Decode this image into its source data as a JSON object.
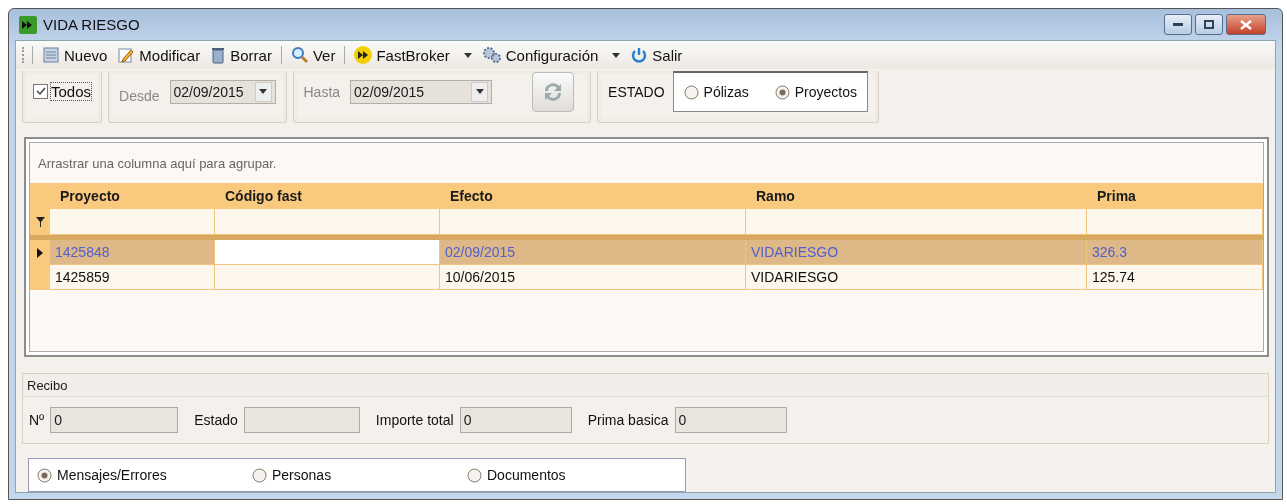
{
  "window": {
    "title": "VIDA RIESGO"
  },
  "toolbar": [
    {
      "kind": "button",
      "label": "Nuevo"
    },
    {
      "kind": "button",
      "label": "Modificar"
    },
    {
      "kind": "button",
      "label": "Borrar"
    },
    {
      "kind": "separator"
    },
    {
      "kind": "button",
      "label": "Ver"
    },
    {
      "kind": "separator"
    },
    {
      "kind": "dropdown",
      "label": "FastBroker"
    },
    {
      "kind": "dropdown",
      "label": "Configuración"
    },
    {
      "kind": "button",
      "label": "Salir"
    }
  ],
  "filters": {
    "todos": {
      "label": "Todos",
      "checked": true
    },
    "desde": {
      "label": "Desde",
      "value": "02/09/2015"
    },
    "hasta": {
      "label": "Hasta",
      "value": "02/09/2015"
    },
    "estado": {
      "label": "ESTADO",
      "options": [
        {
          "label": "Pólizas",
          "selected": false
        },
        {
          "label": "Proyectos",
          "selected": true
        }
      ]
    }
  },
  "grid": {
    "group_hint": "Arrastrar una columna aquí para agrupar.",
    "columns": [
      "Proyecto",
      "Código fast",
      "Efecto",
      "Ramo",
      "Prima"
    ],
    "rows": [
      {
        "selected": true,
        "cells": [
          "1425848",
          "",
          "02/09/2015",
          "VIDARIESGO",
          "326.3"
        ]
      },
      {
        "selected": false,
        "cells": [
          "1425859",
          "",
          "10/06/2015",
          "VIDARIESGO",
          "125.74"
        ]
      }
    ]
  },
  "recibo": {
    "title": "Recibo",
    "fields": [
      {
        "label": "Nº",
        "value": "0"
      },
      {
        "label": "Estado"
      },
      {
        "label": "Importe total",
        "value": "0"
      },
      {
        "label": "Prima basica",
        "value": "0"
      }
    ]
  },
  "bottom_options": [
    {
      "label": "Mensajes/Errores",
      "selected": true
    },
    {
      "label": "Personas",
      "selected": false
    },
    {
      "label": "Documentos",
      "selected": false
    }
  ]
}
